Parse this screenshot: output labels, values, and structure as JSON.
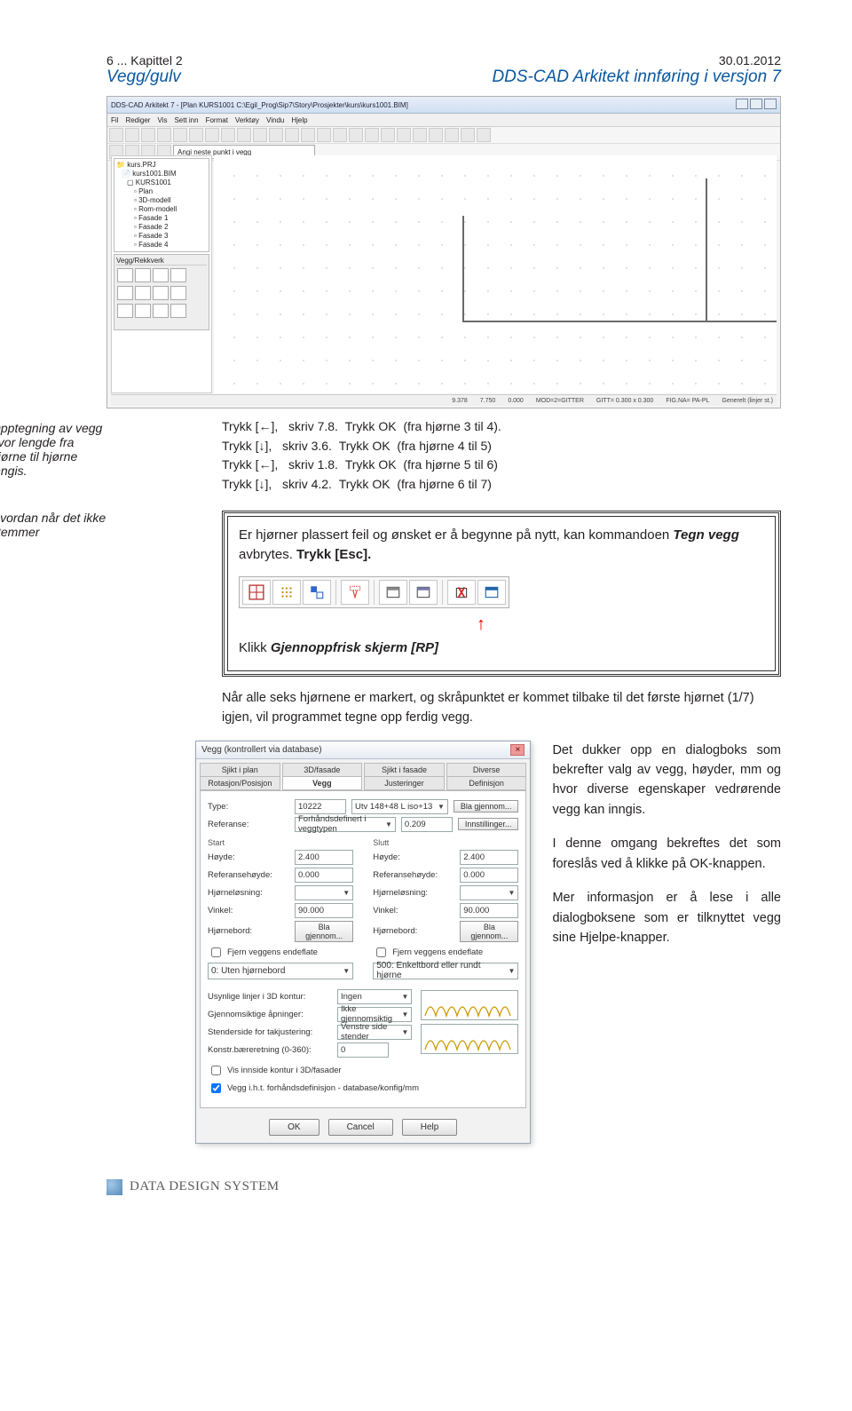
{
  "hdr": {
    "l1": "6 ... Kapittel 2",
    "l2": "Vegg/gulv",
    "r1": "30.01.2012",
    "r2": "DDS-CAD Arkitekt innføring i versjon 7"
  },
  "shot": {
    "title": "DDS-CAD Arkitekt 7 - [Plan KURS1001 C:\\Egil_Prog\\Sip7\\Story\\Prosjekter\\kurs\\kurs1001.BIM]",
    "menus": [
      "Fil",
      "Rediger",
      "Vis",
      "Sett inn",
      "Format",
      "Verktøy",
      "Vindu",
      "Hjelp"
    ],
    "field": "Angi neste punkt i vegg",
    "tree": {
      "root": "kurs.PRJ",
      "bim": "kurs1001.BIM",
      "grp": "KURS1001",
      "items": [
        "Plan",
        "3D-modell",
        "Rom-modell",
        "Fasade 1",
        "Fasade 2",
        "Fasade 3",
        "Fasade 4"
      ]
    },
    "panelTitle": "Vegg/Rekkverk",
    "status": [
      "9.378",
      "7.750",
      "0.000",
      "MOD=2=GITTER",
      "GITT= 0.300 x 0.300",
      "FIG.NA= PA-PL",
      "Generelt (linjer st.)"
    ]
  },
  "cap1": "Opptegning av vegg hvor lengde fra hjørne til hjørne inngis.",
  "keys": [
    {
      "a": "Trykk [←],",
      "b": "skriv 7.8.",
      "c": "Trykk OK",
      "d": "(fra hjørne 3 til 4)."
    },
    {
      "a": "Trykk [↓],",
      "b": "skriv 3.6.",
      "c": "Trykk OK",
      "d": "(fra hjørne 4 til 5)"
    },
    {
      "a": "Trykk [←],",
      "b": "skriv 1.8.",
      "c": "Trykk OK",
      "d": "(fra hjørne 5 til 6)"
    },
    {
      "a": "Trykk [↓],",
      "b": "skriv 4.2.",
      "c": "Trykk OK",
      "d": "(fra hjørne 6 til 7)"
    }
  ],
  "cap2": "Hvordan når det ikke stemmer",
  "box": {
    "p1a": "Er hjørner plassert feil og ønsket er å begynne på nytt, kan kommandoen ",
    "p1b": "Tegn vegg ",
    "p1c": "avbrytes. ",
    "p1d": "Trykk [Esc].",
    "p2a": "Klikk ",
    "p2b": "Gjennoppfrisk skjerm [RP]"
  },
  "para": "Når alle seks hjørnene er markert, og skråpunktet er kommet tilbake til det første hjørnet (1/7) igjen, vil programmet tegne opp ferdig vegg.",
  "dlg": {
    "title": "Vegg (kontrollert via database)",
    "tabs1": [
      "Sjikt i plan",
      "3D/fasade",
      "Sjikt i fasade",
      "Diverse"
    ],
    "tabs2": [
      "Rotasjon/Posisjon",
      "Vegg",
      "Justeringer",
      "Definisjon"
    ],
    "type_l": "Type:",
    "type_code": "10222",
    "type_desc": "Utv 148+48 L iso+13",
    "bla": "Bla gjennom...",
    "ref_l": "Referanse:",
    "ref_v": "Forhåndsdefinert i veggtypen",
    "ref_n": "0.209",
    "innst": "Innstillinger...",
    "start": "Start",
    "slutt": "Slutt",
    "hoyde_l": "Høyde:",
    "hoyde_v": "2.400",
    "refh_l": "Referansehøyde:",
    "refh_v": "0.000",
    "hl_l": "Hjørneløsning:",
    "vink_l": "Vinkel:",
    "vink_v": "90.000",
    "hb_l": "Hjørnebord:",
    "hb_v": "Bla gjennom...",
    "chk1": "Fjern veggens endeflate",
    "sel0_l": "0: Uten hjørnebord",
    "sel500": "500: Enkeltbord eller rundt hjørne",
    "u3d_l": "Usynlige linjer i 3D kontur:",
    "u3d_v": "Ingen",
    "ga_l": "Gjennomsiktige åpninger:",
    "ga_v": "Ikke gjennomsiktig",
    "st_l": "Stenderside for takjustering:",
    "st_v": "Venstre side stender",
    "kb_l": "Konstr.bæreretning (0-360):",
    "kb_v": "0",
    "chk2": "Vis innside kontur i 3D/fasader",
    "chk3": "Vegg i.h.t. forhåndsdefinisjon - database/konfig/mm",
    "ok": "OK",
    "cancel": "Cancel",
    "help": "Help"
  },
  "side": {
    "p1": "Det dukker opp en dialogboks som bekrefter valg av vegg, høyder, mm og hvor diverse egenskaper vedrørende vegg kan inngis.",
    "p2": "I denne omgang bekreftes det som foreslås ved å klikke på OK-knappen.",
    "p3": "Mer informasjon er å lese i alle dialogboksene som er tilknyttet vegg sine Hjelpe-knapper."
  },
  "foot": "DATA DESIGN SYSTEM"
}
